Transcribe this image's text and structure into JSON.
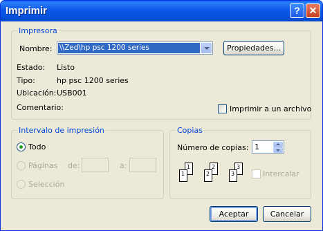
{
  "window": {
    "title": "Imprimir",
    "help_label": "?",
    "close_label": "✕"
  },
  "printer": {
    "legend": "Impresora",
    "name_label": "Nombre:",
    "selected_printer": "\\\\Zed\\hp psc 1200 series",
    "properties_button": "Propiedades...",
    "status_label": "Estado:",
    "status_value": "Listo",
    "type_label": "Tipo:",
    "type_value": "hp psc 1200 series",
    "location_label": "Ubicación:",
    "location_value": "USB001",
    "comment_label": "Comentario:",
    "print_to_file_label": "Imprimir a un archivo",
    "print_to_file_checked": false
  },
  "range": {
    "legend": "Intervalo de impresión",
    "all_label": "Todo",
    "pages_label": "Páginas",
    "from_label": "de:",
    "to_label": "a:",
    "from_value": "",
    "to_value": "",
    "selection_label": "Selección",
    "selected": "all"
  },
  "copies": {
    "legend": "Copias",
    "count_label": "Número de copias:",
    "count_value": "1",
    "collate_label": "Intercalar",
    "collate_checked": false,
    "page_numbers": [
      "1",
      "2",
      "3"
    ]
  },
  "buttons": {
    "ok": "Aceptar",
    "cancel": "Cancelar"
  },
  "icons": {
    "help": "help-icon",
    "close": "close-icon",
    "dropdown": "chevron-down-icon",
    "spin_up": "spin-up-icon",
    "spin_down": "spin-down-icon"
  },
  "colors": {
    "titlebar": "#0a5ef4",
    "face": "#ece9d8",
    "legend_text": "#0046d5",
    "selection": "#316ac5",
    "close_button": "#c6401f"
  }
}
